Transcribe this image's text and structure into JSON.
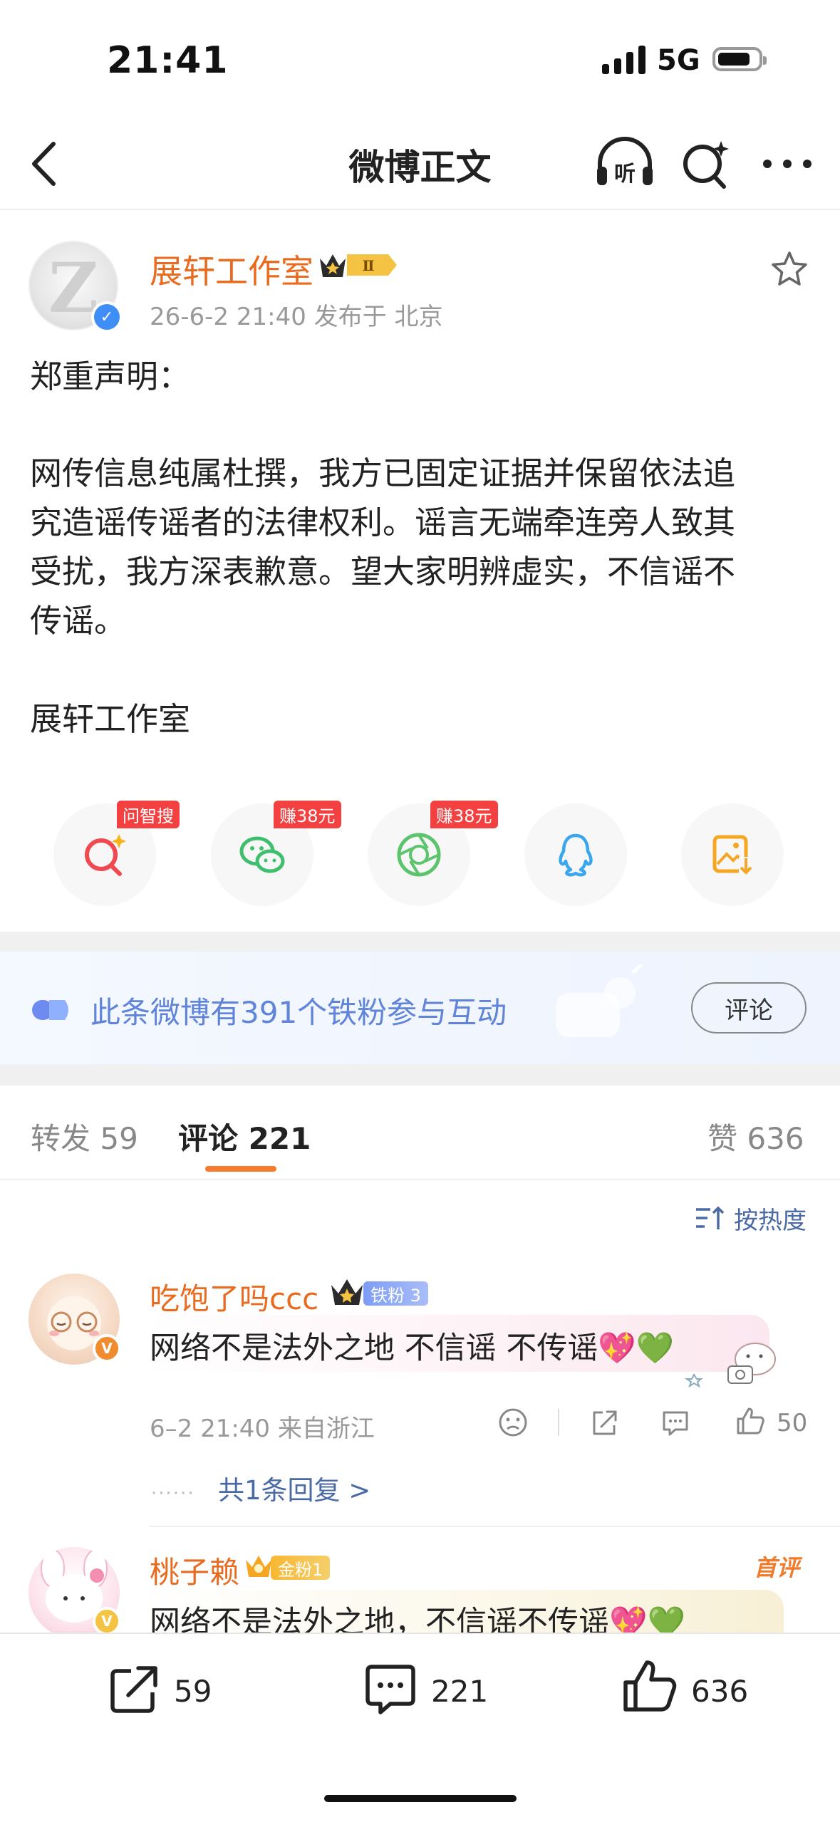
{
  "status_bar": {
    "time": "21:41",
    "network": "5G"
  },
  "nav": {
    "title": "微博正文",
    "listen_icon": "listen-icon",
    "search_icon": "ai-search-icon",
    "more_icon": "more-icon"
  },
  "post": {
    "author": "展轩工作室",
    "badge_text": "Ⅱ",
    "meta": "26-6-2 21:40  发布于 北京",
    "lines": [
      "郑重声明：",
      "网传信息纯属杜撰，我方已固定证据并保留依法追",
      "究造谣传谣者的法律权利。谣言无端牵连旁人致其",
      "受扰，我方深表歉意。望大家明辨虚实，不信谣不",
      "传谣。",
      "展轩工作室"
    ]
  },
  "share": {
    "tags": [
      "问智搜",
      "赚38元",
      "赚38元"
    ],
    "icons": [
      "zhisou-icon",
      "wechat-icon",
      "moments-icon",
      "qq-icon",
      "save-image-icon"
    ]
  },
  "fans_banner": {
    "text": "此条微博有391个铁粉参与互动",
    "button": "评论"
  },
  "tabs": {
    "repost": "转发 59",
    "comment": "评论 221",
    "like": "赞 636"
  },
  "sort": "按热度",
  "comments": [
    {
      "name": "吃饱了吗ccc",
      "badge": "铁粉 3",
      "text": "网络不是法外之地 不信谣 不传谣💖💚",
      "meta": "6–2 21:40  来自浙江",
      "likes": "50",
      "replies": "共1条回复 >"
    },
    {
      "name": "桃子赖",
      "badge": "金粉1",
      "top_label": "首评",
      "text": "网络不是法外之地，不信谣不传谣💖💚"
    }
  ],
  "bottom_bar": {
    "repost": "59",
    "comment": "221",
    "like": "636"
  },
  "colors": {
    "accent": "#e86b1f",
    "link": "#4a6aa5",
    "banner_text": "#5f84d9",
    "tag_red": "#f34141"
  }
}
